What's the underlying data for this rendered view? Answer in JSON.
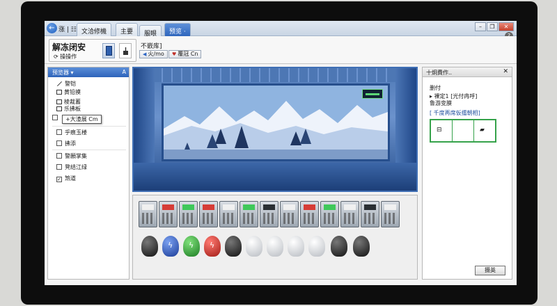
{
  "titlebar": {
    "nav_label": "涨 | ☷",
    "tabs": [
      {
        "label": "文洽修機"
      },
      {
        "label": "主要"
      },
      {
        "label": "服眼"
      },
      {
        "label": "预览 ·"
      }
    ],
    "controls": {
      "minimize": "–",
      "restore": "❐",
      "close": "✕"
    },
    "help": "?"
  },
  "ribbon": {
    "group_title": "解冻闭安",
    "group_sub": "⟳ 操操作",
    "label": "不嵌库]",
    "btn1": "火/mo",
    "btn2": "覆冠 Cn"
  },
  "left_panel": {
    "header": "预览器 ▾",
    "pin": "A",
    "tool_items": [
      "警铠",
      "黄铅摸",
      "棱裁蓄",
      "乐拂板"
    ],
    "tooltip": "+大渣展 Cm",
    "check_items": [
      {
        "label": "乎痕玉楼",
        "checked": false
      },
      {
        "label": "拂添",
        "checked": false
      },
      {
        "label": "警願掌集",
        "checked": false
      },
      {
        "label": "凳结江绿",
        "checked": false
      },
      {
        "label": "煞道",
        "checked": true
      }
    ]
  },
  "right_panel": {
    "title": "十炯費作..",
    "close": "✕",
    "line1": "删付",
    "line2": "▸ 裸定1 [光付冉呼]",
    "line3": "鲁游变膜",
    "line4": "[ 千度再席仮擂朝相]"
  },
  "footer": {
    "ok_label": "摄英"
  },
  "colors": {
    "accent": "#2f66bd",
    "selection_border": "#35a24a",
    "viewport_bg": "#2f5c9e"
  },
  "icons": {
    "back": "back-arrow-icon",
    "help": "help-icon",
    "pin": "pin-icon"
  }
}
